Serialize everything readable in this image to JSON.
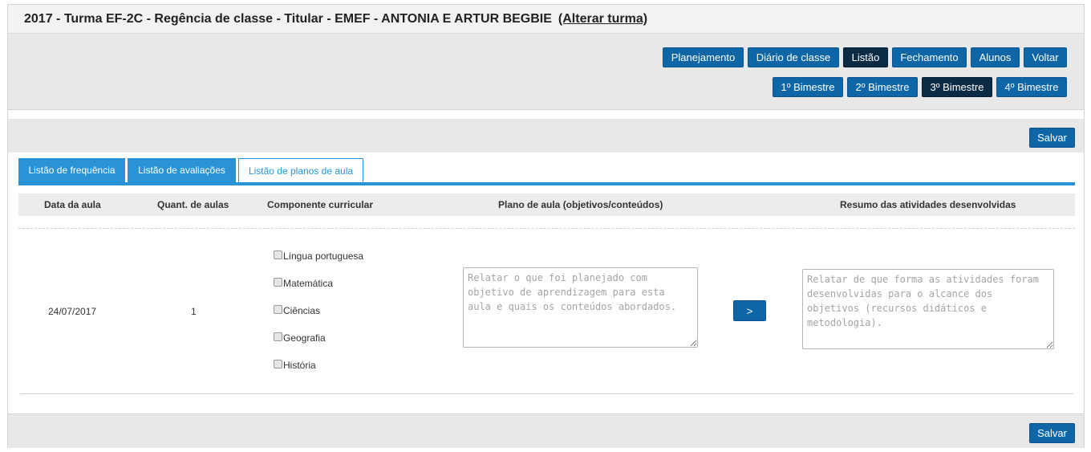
{
  "header": {
    "title": "2017 - Turma EF-2C - Regência de classe - Titular - EMEF - ANTONIA E ARTUR BEGBIE",
    "change_class_link": "(Alterar turma)"
  },
  "nav": {
    "buttons": [
      "Planejamento",
      "Diário de classe",
      "Listão",
      "Fechamento",
      "Alunos",
      "Voltar"
    ],
    "active": "Listão"
  },
  "bimesters": {
    "buttons": [
      "1º Bimestre",
      "2º Bimestre",
      "3º Bimestre",
      "4º Bimestre"
    ],
    "active": "3º Bimestre"
  },
  "save_label": "Salvar",
  "tabs": [
    "Listão de frequência",
    "Listão de avaliações",
    "Listão de planos de aula"
  ],
  "active_tab": "Listão de planos de aula",
  "table": {
    "headers": [
      "Data da aula",
      "Quant. de aulas",
      "Componente curricular",
      "Plano de aula (objetivos/conteúdos)",
      "Resumo das atividades desenvolvidas"
    ],
    "row": {
      "date": "24/07/2017",
      "quantity": "1",
      "components": [
        "Língua portuguesa",
        "Matemática",
        "Ciências",
        "Geografia",
        "História"
      ],
      "plan_placeholder": "Relatar o que foi planejado com objetivo de aprendizagem para esta aula e quais os conteúdos abordados.",
      "copy_button": ">",
      "summary_placeholder": "Relatar de que forma as atividades foram desenvolvidas para o alcance dos objetivos (recursos didáticos e metodologia)."
    }
  },
  "colors": {
    "primary_button": "#0f66a7",
    "active_button": "#0b2a44",
    "tab_accent": "#2a93d5"
  }
}
